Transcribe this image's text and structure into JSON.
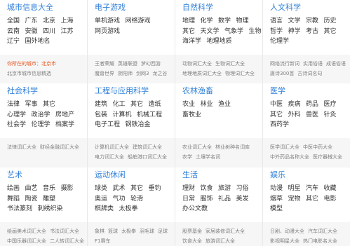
{
  "colors": {
    "title": "#2f7fd8",
    "item": "#333333",
    "featured": "#808080",
    "city_notice": "#e8551f",
    "featured_bg": "#f6f6f6",
    "divider": "#e8e8e8"
  },
  "cells": [
    {
      "title": "城市信息大全",
      "rows": [
        [
          "全国",
          "广东",
          "北京",
          "上海"
        ],
        [
          "云南",
          "安徽",
          "四川",
          "江苏"
        ],
        [
          "辽宁",
          "国外地名"
        ]
      ],
      "city_notice": "你所在的城市：北京市",
      "featured": [
        [
          "北京市城市信息精选"
        ]
      ]
    },
    {
      "title": "电子游戏",
      "rows": [
        [
          "单机游戏",
          "网络游戏"
        ],
        [
          "网页游戏"
        ]
      ],
      "featured": [
        [
          "王者荣耀",
          "英雄联盟",
          "梦幻西游"
        ],
        [
          "魔兽世界",
          "阴阳师",
          "剑网3",
          "龙之谷"
        ]
      ]
    },
    {
      "title": "自然科学",
      "rows": [
        [
          "地理",
          "化学",
          "数学",
          "物理"
        ],
        [
          "其它",
          "天文学",
          "气象学",
          "生物"
        ],
        [
          "海洋学",
          "地理地质"
        ]
      ],
      "featured": [
        [
          "动物词汇大全",
          "生物词汇大全"
        ],
        [
          "地理地质词汇大全",
          "物理词汇大全"
        ]
      ]
    },
    {
      "title": "人文科学",
      "rows": [
        [
          "语言",
          "文学",
          "宗教",
          "历史"
        ],
        [
          "哲学",
          "神学",
          "考古",
          "其它"
        ],
        [
          "伦理学"
        ]
      ],
      "featured": [
        [
          "网络流行新词",
          "实用俗语",
          "成语俗语"
        ],
        [
          "唐诗300首",
          "古诗词名句"
        ]
      ]
    },
    {
      "title": "社会科学",
      "rows": [
        [
          "法律",
          "军事",
          "其它"
        ],
        [
          "心理学",
          "政治学",
          "房地产"
        ],
        [
          "社会学",
          "伦理学",
          "档案学"
        ]
      ],
      "featured": [
        [
          "法律词汇大全",
          "财经金融词汇大全"
        ]
      ]
    },
    {
      "title": "工程与应用科学",
      "rows": [
        [
          "建筑",
          "化工",
          "其它",
          "造纸"
        ],
        [
          "包装",
          "计算机",
          "机械工程"
        ],
        [
          "电子工程",
          "钢铁冶金"
        ]
      ],
      "featured": [
        [
          "计算机词汇大全",
          "建筑词汇大全"
        ],
        [
          "电力词汇大全",
          "船舶港口词汇大全"
        ]
      ]
    },
    {
      "title": "农林渔畜",
      "rows": [
        [
          "农业",
          "林业",
          "渔业"
        ],
        [
          "畜牧业"
        ]
      ],
      "featured": [
        [
          "农业词汇大全",
          "林业树种名词库"
        ],
        [
          "农学",
          "土壤学名词"
        ]
      ]
    },
    {
      "title": "医学",
      "rows": [
        [
          "中医",
          "疾病",
          "药品",
          "医疗"
        ],
        [
          "其它",
          "外科",
          "兽医",
          "针灸"
        ],
        [
          "西药学"
        ]
      ],
      "featured": [
        [
          "医学词汇大全",
          "中医中药大全"
        ],
        [
          "中外药品名称大全",
          "医疗器械大全"
        ]
      ]
    },
    {
      "title": "艺术",
      "rows": [
        [
          "绘画",
          "曲艺",
          "音乐",
          "摄影"
        ],
        [
          "舞蹈",
          "陶瓷",
          "雕塑"
        ],
        [
          "书法篆刻",
          "刺绣织染"
        ]
      ],
      "featured": [
        [
          "绘画美术词汇大全",
          "书法词汇大全"
        ],
        [
          "中国乐器词汇大全",
          "二人转词汇大全"
        ]
      ]
    },
    {
      "title": "运动休闲",
      "rows": [
        [
          "球类",
          "武术",
          "其它",
          "垂钓"
        ],
        [
          "奥运",
          "气功",
          "轮滑"
        ],
        [
          "棋牌类",
          "太极拳"
        ]
      ],
      "featured": [
        [
          "象棋",
          "篮球",
          "太极拳",
          "羽毛球",
          "足球"
        ],
        [
          "F1赛车"
        ]
      ]
    },
    {
      "title": "生活",
      "rows": [
        [
          "理财",
          "饮食",
          "旅游",
          "习俗"
        ],
        [
          "日常",
          "服饰",
          "礼品",
          "美发"
        ],
        [
          "办公文教"
        ]
      ],
      "featured": [
        [
          "股票基金",
          "家居装修词汇大全"
        ],
        [
          "饮食大全",
          "旅游词汇大全"
        ]
      ]
    },
    {
      "title": "娱乐",
      "rows": [
        [
          "动漫",
          "明星",
          "汽车",
          "收藏"
        ],
        [
          "烟草",
          "宠物",
          "其它",
          "电影"
        ],
        [
          "模型"
        ]
      ],
      "featured": [
        [
          "日剧、动漫大全",
          "汽车词汇大全"
        ],
        [
          "影视明星大全",
          "热门电影名大全"
        ]
      ]
    }
  ]
}
